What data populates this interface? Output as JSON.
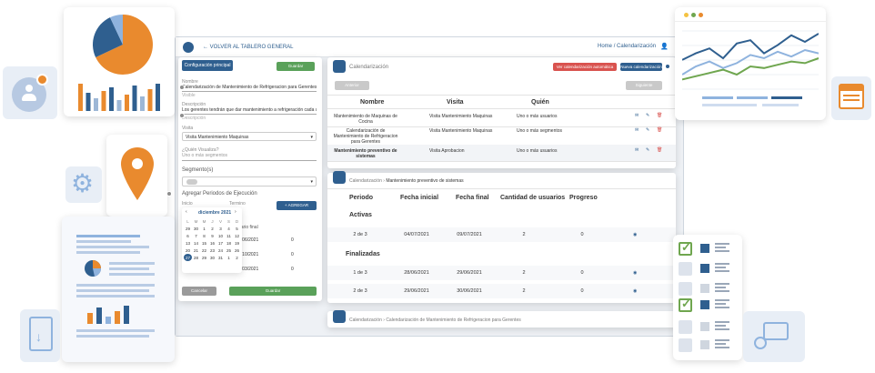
{
  "header": {
    "back_label": "VOLVER AL TABLERO GENERAL",
    "breadcrumb_home": "Home",
    "breadcrumb_sep": "/",
    "breadcrumb_current": "Calendarización"
  },
  "form": {
    "title": "Configuración principal",
    "save_label": "Guardar",
    "name_label": "Nombre",
    "name_value": "Calendarización de Mantenimiento de Refrigeracion para Gerentes",
    "name_hint": "Visible",
    "desc_label": "Descripción",
    "desc_value": "Los gerentes tendrán que dar mantenimiento a refrigeración cada ultima semana",
    "desc_hint": "Descripción",
    "visit_label": "Visita",
    "visit_value": "Visita Mantenimiento Maquinas",
    "users_label": "¿Quién Visualiza?",
    "users_value": "Uno o más segmentos",
    "segment_label": "Segmento(s)",
    "periods_label": "Agregar Periodos de Ejecución",
    "start_label": "Inicio",
    "end_label": "Termino",
    "add_label": "AGREGAR",
    "total_label": "uario final",
    "rows": [
      {
        "date": "1/06/2021",
        "n": "0"
      },
      {
        "date": "1/10/2021",
        "n": "0"
      },
      {
        "date": "1/03/2021",
        "n": "0"
      }
    ],
    "cancel_label": "Cancelar",
    "submit_label": "Guardar"
  },
  "calendar": {
    "month": "diciembre 2021",
    "weekdays": [
      "L",
      "M",
      "M",
      "J",
      "V",
      "S",
      "D"
    ],
    "weeks": [
      [
        "29",
        "30",
        "1",
        "2",
        "3",
        "4",
        "5"
      ],
      [
        "6",
        "7",
        "8",
        "9",
        "10",
        "11",
        "12"
      ],
      [
        "13",
        "14",
        "15",
        "16",
        "17",
        "18",
        "19"
      ],
      [
        "20",
        "21",
        "22",
        "23",
        "24",
        "25",
        "26"
      ],
      [
        "27",
        "28",
        "29",
        "30",
        "31",
        "1",
        "2"
      ]
    ]
  },
  "calendarization": {
    "title": "Calendarización",
    "red_button": "Ver calendarización automática",
    "new_button": "Nueva calendarización",
    "prev_button": "Anterior",
    "next_button": "Siguiente",
    "columns": [
      "Nombre",
      "Visita",
      "Quién"
    ],
    "rows": [
      {
        "name": "Mantenimiento de Maquinas de Cocina",
        "visit": "Visita Mantenimiento Maquinas",
        "who": "Uno o más usuarios",
        "bold": false
      },
      {
        "name": "Calendarización de Mantenimiento de Refrigeracion para Gerentes",
        "visit": "Visita Mantenimiento Maquinas",
        "who": "Uno o más segmentos",
        "bold": false
      },
      {
        "name": "Mantenimiento preventivo de sistemas",
        "visit": "Visita Aprobacion",
        "who": "Uno o más usuarios",
        "bold": true
      }
    ]
  },
  "periods": {
    "crumb": "Calendarización",
    "crumb_value": "Mantenimiento preventivo de sistemas",
    "columns": [
      "Periodo",
      "Fecha inicial",
      "Fecha final",
      "Cantidad de usuarios",
      "Progreso"
    ],
    "active_label": "Activas",
    "active_rows": [
      {
        "period": "2 de 3",
        "start": "04/07/2021",
        "end": "09/07/2021",
        "users": "2",
        "progress": "0"
      }
    ],
    "finished_label": "Finalizadas",
    "finished_rows": [
      {
        "period": "1 de 3",
        "start": "28/06/2021",
        "end": "29/06/2021",
        "users": "2",
        "progress": "0"
      },
      {
        "period": "2 de 3",
        "start": "29/06/2021",
        "end": "30/06/2021",
        "users": "2",
        "progress": "0"
      }
    ]
  },
  "bottom_bar": {
    "crumb": "Calendarización",
    "crumb_value": "Calendarización de Mantenimiento de Refrigeracion para Gerentes"
  },
  "pie_chart": {
    "slices": [
      {
        "value": 68,
        "color": "#e98a2e"
      },
      {
        "value": 25,
        "color": "#2f5f8f"
      },
      {
        "value": 7,
        "color": "#8fb3de"
      }
    ],
    "bars": [
      {
        "value": 30,
        "color": "#e98a2e"
      },
      {
        "value": 20,
        "color": "#2f5f8f"
      },
      {
        "value": 14,
        "color": "#9db7d6"
      },
      {
        "value": 22,
        "color": "#e98a2e"
      },
      {
        "value": 26,
        "color": "#2f5f8f"
      },
      {
        "value": 12,
        "color": "#9db7d6"
      },
      {
        "value": 18,
        "color": "#e98a2e"
      },
      {
        "value": 28,
        "color": "#2f5f8f"
      },
      {
        "value": 16,
        "color": "#9db7d6"
      },
      {
        "value": 24,
        "color": "#e98a2e"
      },
      {
        "value": 30,
        "color": "#2f5f8f"
      }
    ]
  },
  "line_chart": {
    "series": [
      {
        "color": "#2f5f8f",
        "values": [
          38,
          46,
          52,
          40,
          58,
          62,
          46,
          56,
          68,
          60,
          70
        ]
      },
      {
        "color": "#8fb3de",
        "values": [
          20,
          30,
          36,
          28,
          34,
          44,
          40,
          48,
          42,
          50,
          46
        ]
      },
      {
        "color": "#6fa64f",
        "values": [
          14,
          18,
          22,
          26,
          20,
          30,
          28,
          32,
          36,
          34,
          40
        ]
      }
    ],
    "window_dot_colors": [
      "#f4c242",
      "#6fa64f",
      "#e98a2e"
    ]
  },
  "colors": {
    "brand": "#2f5f8f",
    "accent": "#e98a2e",
    "success": "#5aa15a",
    "danger": "#d9534f"
  }
}
